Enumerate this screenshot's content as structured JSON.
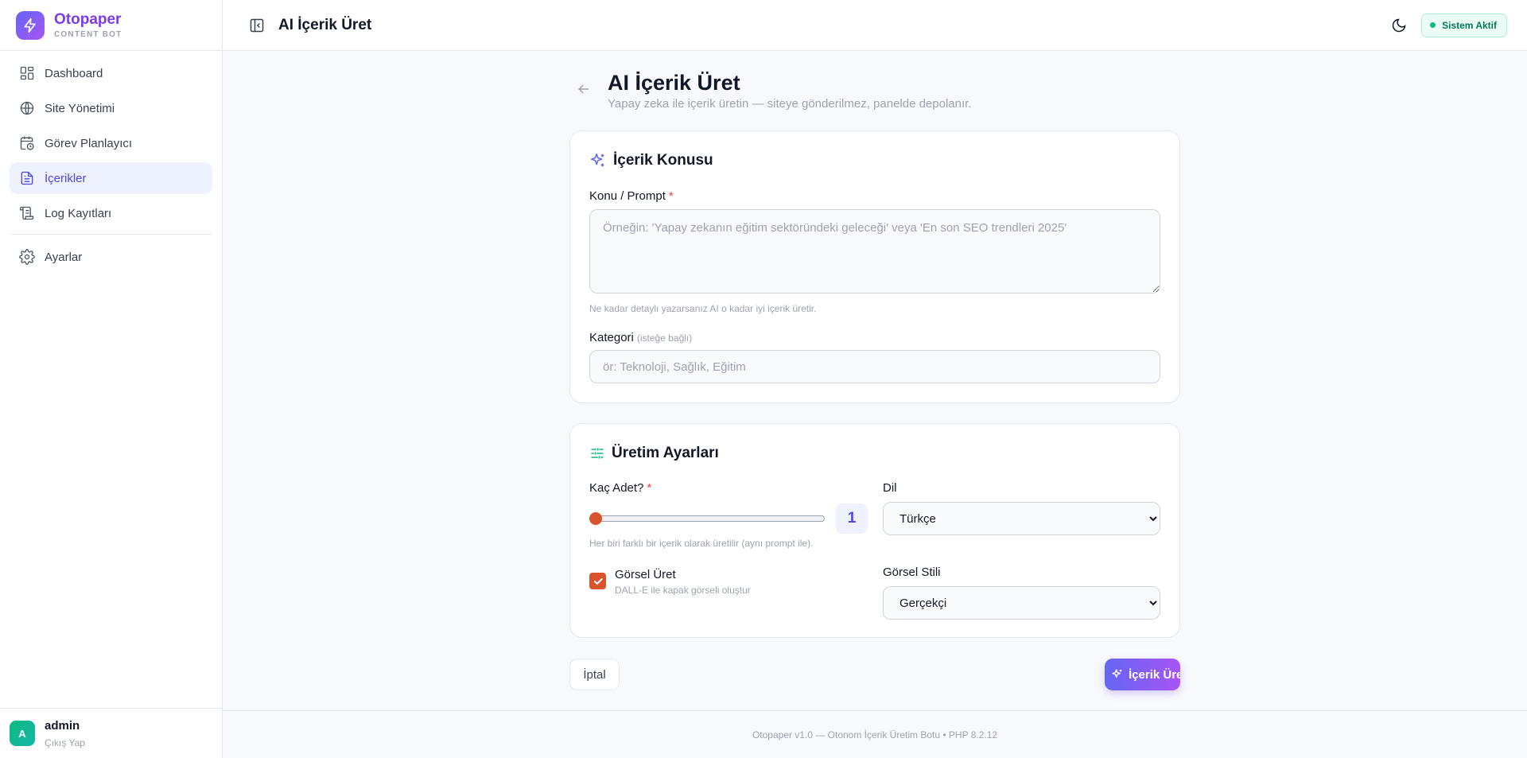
{
  "brand": {
    "name": "Otopaper",
    "subtitle": "CONTENT BOT"
  },
  "sidebar": {
    "items": [
      {
        "label": "Dashboard",
        "icon": "dashboard-icon"
      },
      {
        "label": "Site Yönetimi",
        "icon": "globe-icon"
      },
      {
        "label": "Görev Planlayıcı",
        "icon": "calendar-clock-icon"
      },
      {
        "label": "İçerikler",
        "icon": "file-text-icon",
        "active": true
      },
      {
        "label": "Log Kayıtları",
        "icon": "scroll-icon"
      },
      {
        "label": "Ayarlar",
        "icon": "gear-icon"
      }
    ]
  },
  "user": {
    "initial": "A",
    "name": "admin",
    "logout_label": "Çıkış Yap"
  },
  "header": {
    "title": "AI İçerik Üret",
    "status": "Sistem Aktif"
  },
  "page": {
    "title": "AI İçerik Üret",
    "subtitle": "Yapay zeka ile içerik üretin — siteye gönderilmez, panelde depolanır."
  },
  "topic_card": {
    "title": "İçerik Konusu",
    "prompt_label": "Konu / Prompt",
    "required_mark": "*",
    "prompt_placeholder": "Örneğin: 'Yapay zekanın eğitim sektöründeki geleceği' veya 'En son SEO trendleri 2025'",
    "prompt_hint": "Ne kadar detaylı yazarsanız AI o kadar iyi içerik üretir.",
    "category_label": "Kategori",
    "category_optional": "(isteğe bağlı)",
    "category_placeholder": "ör: Teknoloji, Sağlık, Eğitim"
  },
  "settings_card": {
    "title": "Üretim Ayarları",
    "count_label": "Kaç Adet?",
    "required_mark": "*",
    "count_value": "1",
    "count_hint": "Her biri farklı bir içerik olarak üretilir (aynı prompt ile).",
    "language_label": "Dil",
    "language_value": "Türkçe",
    "image_label": "Görsel Üret",
    "image_sub": "DALL-E ile kapak görseli oluştur",
    "image_checked": true,
    "style_label": "Görsel Stili",
    "style_value": "Gerçekçi"
  },
  "actions": {
    "cancel": "İptal",
    "submit": "İçerik Üret"
  },
  "footer": {
    "text": "Otopaper v1.0 — Otonom İçerik Üretim Botu • PHP 8.2.12"
  },
  "colors": {
    "accent": "#4f46e5",
    "brand": "#7c3aed",
    "success": "#10b981",
    "checkbox": "#d9542a"
  }
}
